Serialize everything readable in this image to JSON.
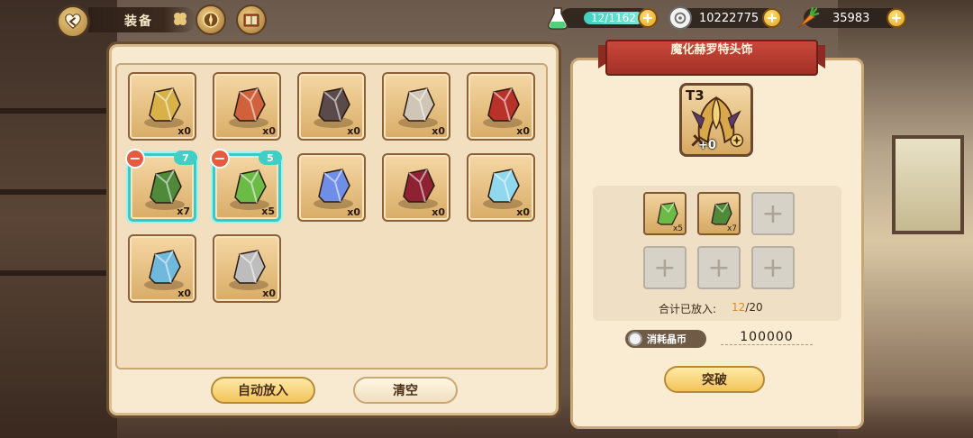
{
  "header": {
    "title": "装备",
    "icons": [
      "back-arrow-heart-icon",
      "clover-icon",
      "compass-icon",
      "book-icon"
    ]
  },
  "resources": {
    "stamina": {
      "value": "12/1162",
      "icon": "potion-flask-icon"
    },
    "coins": {
      "value": "10222775",
      "icon": "coin-icon"
    },
    "carrots": {
      "value": "35983",
      "icon": "carrot-icon"
    },
    "plus_label": "+"
  },
  "materials": [
    {
      "name": "gold-ore",
      "count": "x0",
      "color": "#d8b248"
    },
    {
      "name": "copper-ore",
      "count": "x0",
      "color": "#d0623b"
    },
    {
      "name": "dark-orb",
      "count": "x0",
      "color": "#5a4a4a"
    },
    {
      "name": "silver-orb",
      "count": "x0",
      "color": "#cfc6b6"
    },
    {
      "name": "ember-orb",
      "count": "x0",
      "color": "#b8322a"
    },
    {
      "name": "green-crystal-dark",
      "count": "x7",
      "color": "#4f8a3b",
      "selected": true,
      "selected_count": "7"
    },
    {
      "name": "green-crystal-nest",
      "count": "x5",
      "color": "#6cbb46",
      "selected": true,
      "selected_count": "5"
    },
    {
      "name": "blue-orb",
      "count": "x0",
      "color": "#6f8ee8"
    },
    {
      "name": "crimson-nest",
      "count": "x0",
      "color": "#8e2233"
    },
    {
      "name": "ice-orb",
      "count": "x0",
      "color": "#8fd8ee"
    },
    {
      "name": "ice-shard",
      "count": "x0",
      "color": "#6fb9dc"
    },
    {
      "name": "silver-ore",
      "count": "x0",
      "color": "#bdbdbd"
    }
  ],
  "left_buttons": {
    "auto": "自动放入",
    "clear": "清空"
  },
  "detail": {
    "title": "魔化赫罗特头饰",
    "tier": "T3",
    "level": "+0",
    "slots": [
      {
        "filled": true,
        "count": "x5",
        "color": "#6cbb46"
      },
      {
        "filled": true,
        "count": "x7",
        "color": "#4f8a3b"
      },
      {
        "filled": false
      },
      {
        "filled": false
      },
      {
        "filled": false
      },
      {
        "filled": false
      }
    ],
    "total_label": "合计已放入:",
    "total_current": "12",
    "total_max": "/20",
    "cost_label": "消耗晶币",
    "cost_value": "100000",
    "breakthrough": "突破"
  }
}
